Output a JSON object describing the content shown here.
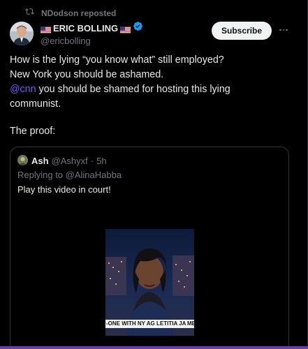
{
  "repost": {
    "text": "NDodson reposted"
  },
  "author": {
    "display_name": "ERIC BOLLING",
    "handle": "@ericbolling"
  },
  "actions": {
    "subscribe_label": "Subscribe"
  },
  "tweet": {
    "line1": "How is the lying  “you know what” still employed?",
    "line2": "New York you should be ashamed.",
    "line3_mention": "@cnn",
    "line3_rest": " you should be shamed for hosting this lying",
    "line4": "communist.",
    "proof": "The proof:"
  },
  "quote": {
    "name": "Ash",
    "handle": "@Ashyxf",
    "separator": "·",
    "time": "5h",
    "replying_to": "Replying to @AlinaHabba",
    "text": "Play this video in court!",
    "video_chyron": "-ONE WITH NY AG LETITIA JA ME"
  },
  "colors": {
    "background": "#000000",
    "text": "#e7e9ea",
    "muted": "#71767b",
    "mention": "#7856ff",
    "verified": "#1d9bf0",
    "border": "#2f3336"
  },
  "icons": [
    "repost-icon",
    "us-flag-icon",
    "verified-badge-icon",
    "more-options-icon"
  ]
}
